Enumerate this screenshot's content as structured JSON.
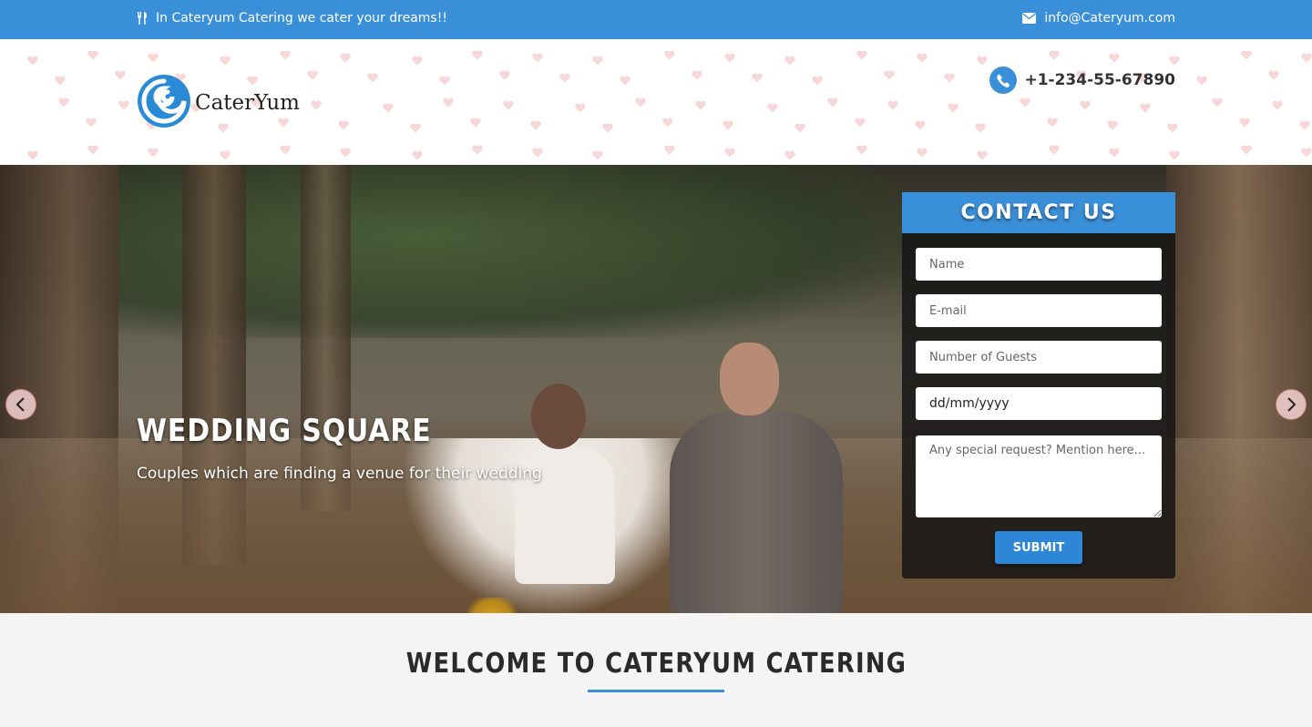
{
  "topbar": {
    "tagline": "In Cateryum Catering we cater your dreams!!",
    "email": "info@Cateryum.com",
    "tagline_icon": "fork-knife-icon",
    "email_icon": "envelope-icon"
  },
  "header": {
    "logo_text": "CaterYum",
    "phone": "+1-234-55-67890",
    "phone_icon": "phone-icon"
  },
  "hero": {
    "title": "WEDDING SQUARE",
    "subtitle": "Couples which are finding a venue for their wedding",
    "prev_icon": "chevron-left-icon",
    "next_icon": "chevron-right-icon"
  },
  "contact": {
    "heading": "CONTACT US",
    "name_placeholder": "Name",
    "email_placeholder": "E-mail",
    "guests_placeholder": "Number of Guests",
    "date_value": "dd/mm/yyyy",
    "request_placeholder": "Any special request? Mention here...",
    "submit_label": "SUBMIT"
  },
  "welcome": {
    "title": "WELCOME TO CATERYUM CATERING"
  },
  "colors": {
    "brand_blue": "#3a8fd9",
    "arrow_bg": "#f5d2d2"
  }
}
